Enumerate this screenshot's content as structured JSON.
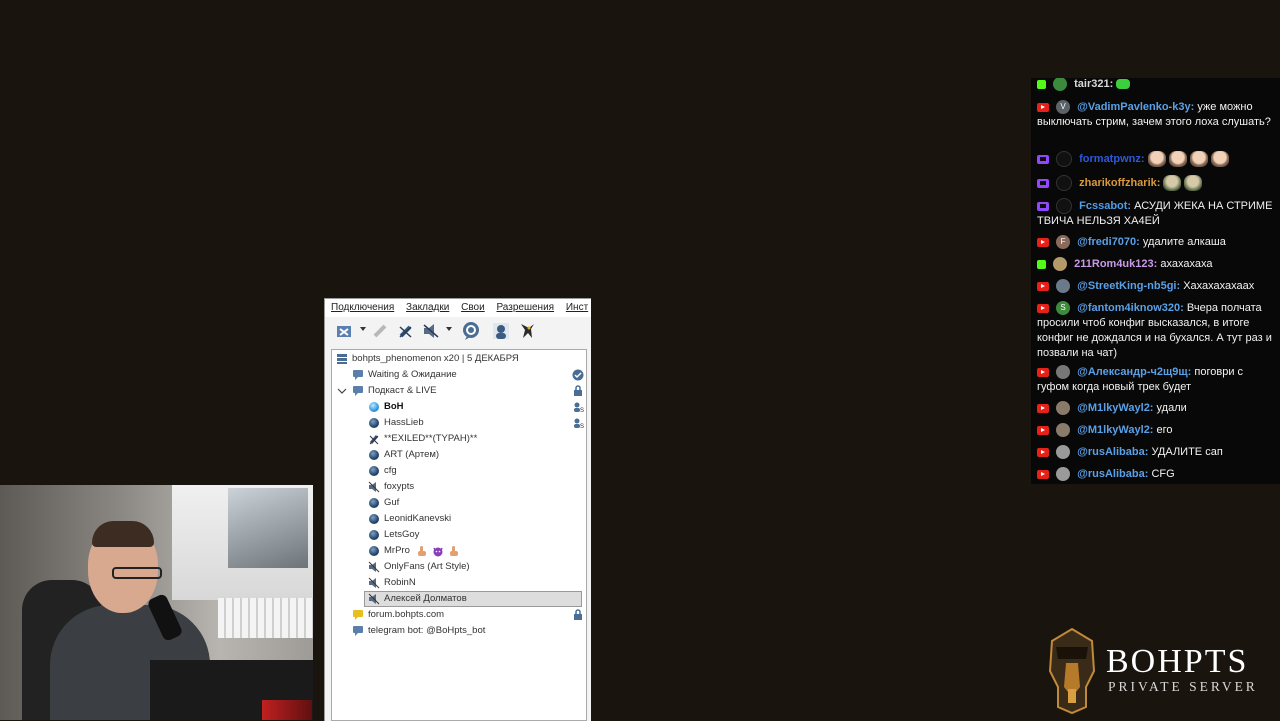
{
  "teamspeak": {
    "menu": [
      "Подключения",
      "Закладки",
      "Свои",
      "Разрешения",
      "Инст"
    ],
    "toolbar_icons": [
      "disconnect-icon",
      "away-icon",
      "mute-microphone-icon",
      "mute-speakers-icon",
      "chat-icon",
      "contacts-icon",
      "wolf-icon"
    ],
    "server_name": "bohpts_phenomenon x20 | 5 ДЕКАБРЯ",
    "channels": [
      {
        "label": "Waiting & Ожидание"
      },
      {
        "label": "Подкаст & LIVE"
      }
    ],
    "users": [
      {
        "name": "BoH"
      },
      {
        "name": "HassLieb"
      },
      {
        "name": "**EXILED**(TYPAH)**"
      },
      {
        "name": "ART (Артем)"
      },
      {
        "name": "cfg"
      },
      {
        "name": "foxypts"
      },
      {
        "name": "Guf"
      },
      {
        "name": "LeonidKanevski"
      },
      {
        "name": "LetsGoy"
      },
      {
        "name": "MrPro"
      },
      {
        "name": "OnlyFans (Art Style)"
      },
      {
        "name": "RobinN"
      },
      {
        "name": "Алексей Долматов"
      }
    ],
    "extra_channels": [
      {
        "label": "forum.bohpts.com"
      },
      {
        "label": "telegram bot: @BoHpts_bot"
      }
    ]
  },
  "chat": {
    "messages": [
      {
        "platform": "kick",
        "user": "tair321:",
        "text": "",
        "color": "#d8d8d8"
      },
      {
        "platform": "youtube",
        "avatar": "V",
        "avatar_color": "#5b6268",
        "user": "@VadimPavlenko-k3y:",
        "text": "уже можно выключать стрим, зачем этого лоха слушать?",
        "color": "#5aa0e6"
      },
      {
        "platform": "twitch",
        "user": "formatpwnz:",
        "text": "",
        "color": "#2b5ad8"
      },
      {
        "platform": "twitch",
        "user": "zharikoffzharik:",
        "text": "",
        "color": "#d89a3c"
      },
      {
        "platform": "twitch",
        "user": "Fcssabot:",
        "text": "АСУДИ ЖЕКА НА СТРИМЕ ТВИЧА НЕЛЬЗЯ ХА4ЕЙ",
        "color": "#4f9de8"
      },
      {
        "platform": "youtube",
        "avatar": "F",
        "avatar_color": "#8a6a5a",
        "user": "@fredi7070:",
        "text": "удалите алкаша",
        "color": "#5aa0e6"
      },
      {
        "platform": "kick",
        "avatar": "",
        "avatar_color": "#b59a6a",
        "user": "211Rom4uk123:",
        "text": "ахахахаха",
        "color": "#c89ae8"
      },
      {
        "platform": "youtube",
        "avatar": "",
        "avatar_color": "#6a7a8a",
        "user": "@StreetKing-nb5gi:",
        "text": "Хахахахахаах",
        "color": "#5aa0e6"
      },
      {
        "platform": "youtube",
        "avatar": "S",
        "avatar_color": "#3d8a3d",
        "user": "@fantom4iknow320:",
        "text": "Вчера полчата просили чтоб конфиг высказался, в итоге конфиг не дождался и на бухался. А тут раз и позвали на чат)",
        "color": "#5aa0e6"
      },
      {
        "platform": "youtube",
        "avatar": "",
        "avatar_color": "#777777",
        "user": "@Александр-ч2щ9щ:",
        "text": "поговри с гуфом когда новый трек будет",
        "color": "#5aa0e6"
      },
      {
        "platform": "youtube",
        "avatar": "",
        "avatar_color": "#8a7a6a",
        "user": "@M1lkyWayl2:",
        "text": "удали",
        "color": "#5aa0e6"
      },
      {
        "platform": "youtube",
        "avatar": "",
        "avatar_color": "#8a7a6a",
        "user": "@M1lkyWayl2:",
        "text": "его",
        "color": "#5aa0e6"
      },
      {
        "platform": "youtube",
        "avatar": "",
        "avatar_color": "#9a9a9a",
        "user": "@rusAlibaba:",
        "text": "УДАЛИТЕ сап",
        "color": "#5aa0e6"
      },
      {
        "platform": "youtube",
        "avatar": "",
        "avatar_color": "#9a9a9a",
        "user": "@rusAlibaba:",
        "text": "CFG",
        "color": "#5aa0e6"
      }
    ]
  },
  "logo": {
    "title": "BOHPTS",
    "subtitle": "PRIVATE SERVER"
  }
}
